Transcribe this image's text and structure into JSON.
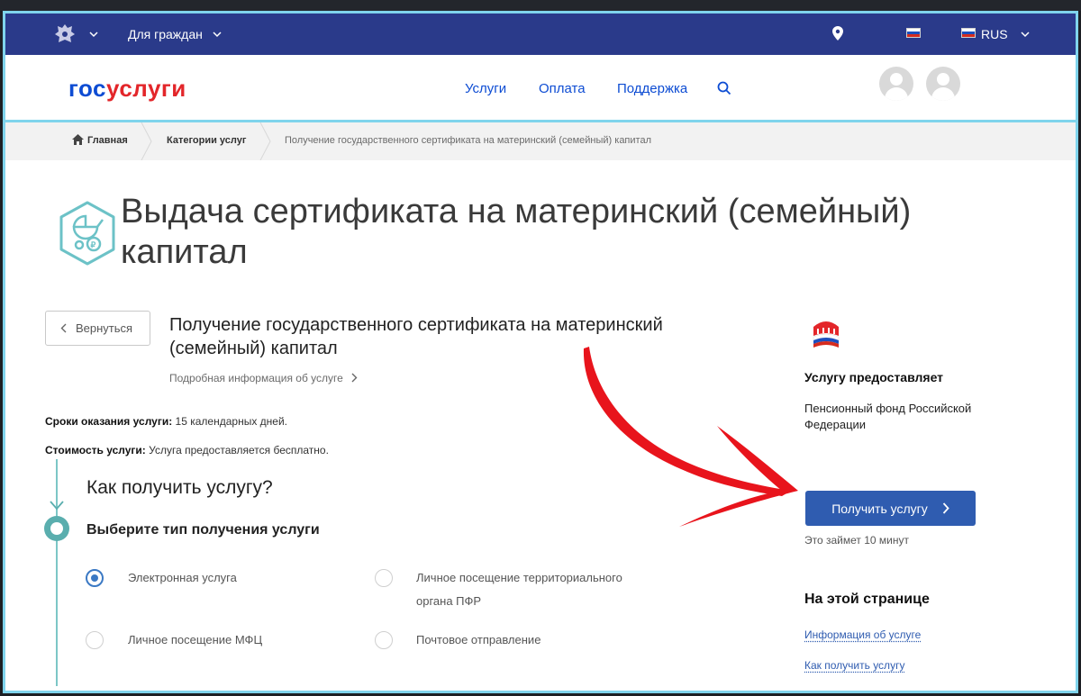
{
  "topbar": {
    "for_citizens": "Для граждан",
    "language": "RUS"
  },
  "header": {
    "logo_part1": "гос",
    "logo_part2": "услуги",
    "nav": [
      "Услуги",
      "Оплата",
      "Поддержка"
    ]
  },
  "breadcrumbs": {
    "home": "Главная",
    "categories": "Категории услуг",
    "current": "Получение государственного сертификата на материнский (семейный) капитал"
  },
  "page": {
    "title": "Выдача сертификата на материнский (семейный) капитал",
    "back": "Вернуться",
    "service_title": "Получение государственного сертификата на материнский (семейный) капитал",
    "more_info": "Подробная информация об услуге",
    "deadline_label": "Сроки оказания услуги:",
    "deadline_value": "15 календарных дней.",
    "cost_label": "Стоимость услуги:",
    "cost_value": "Услуга предоставляется бесплатно.",
    "how_title": "Как получить услугу?",
    "choose_title": "Выберите тип получения услуги",
    "options": [
      {
        "label": "Электронная услуга",
        "selected": true
      },
      {
        "label": "Личное посещение территориального органа ПФР",
        "selected": false
      },
      {
        "label": "Личное посещение МФЦ",
        "selected": false
      },
      {
        "label": "Почтовое отправление",
        "selected": false
      }
    ]
  },
  "sidebar": {
    "provider_head": "Услугу предоставляет",
    "provider_name": "Пенсионный фонд Российской Федерации",
    "get_service": "Получить услугу",
    "takes": "Это займет 10 минут",
    "on_page_head": "На этой странице",
    "links": [
      "Информация об услуге",
      "Как получить услугу"
    ]
  },
  "colors": {
    "topbar": "#2a3a8a",
    "brand_blue": "#0d4cd3",
    "brand_red": "#e3262a",
    "button": "#2f5cb0",
    "timeline": "#5aaeae",
    "annotation_arrow": "#e8141c"
  }
}
